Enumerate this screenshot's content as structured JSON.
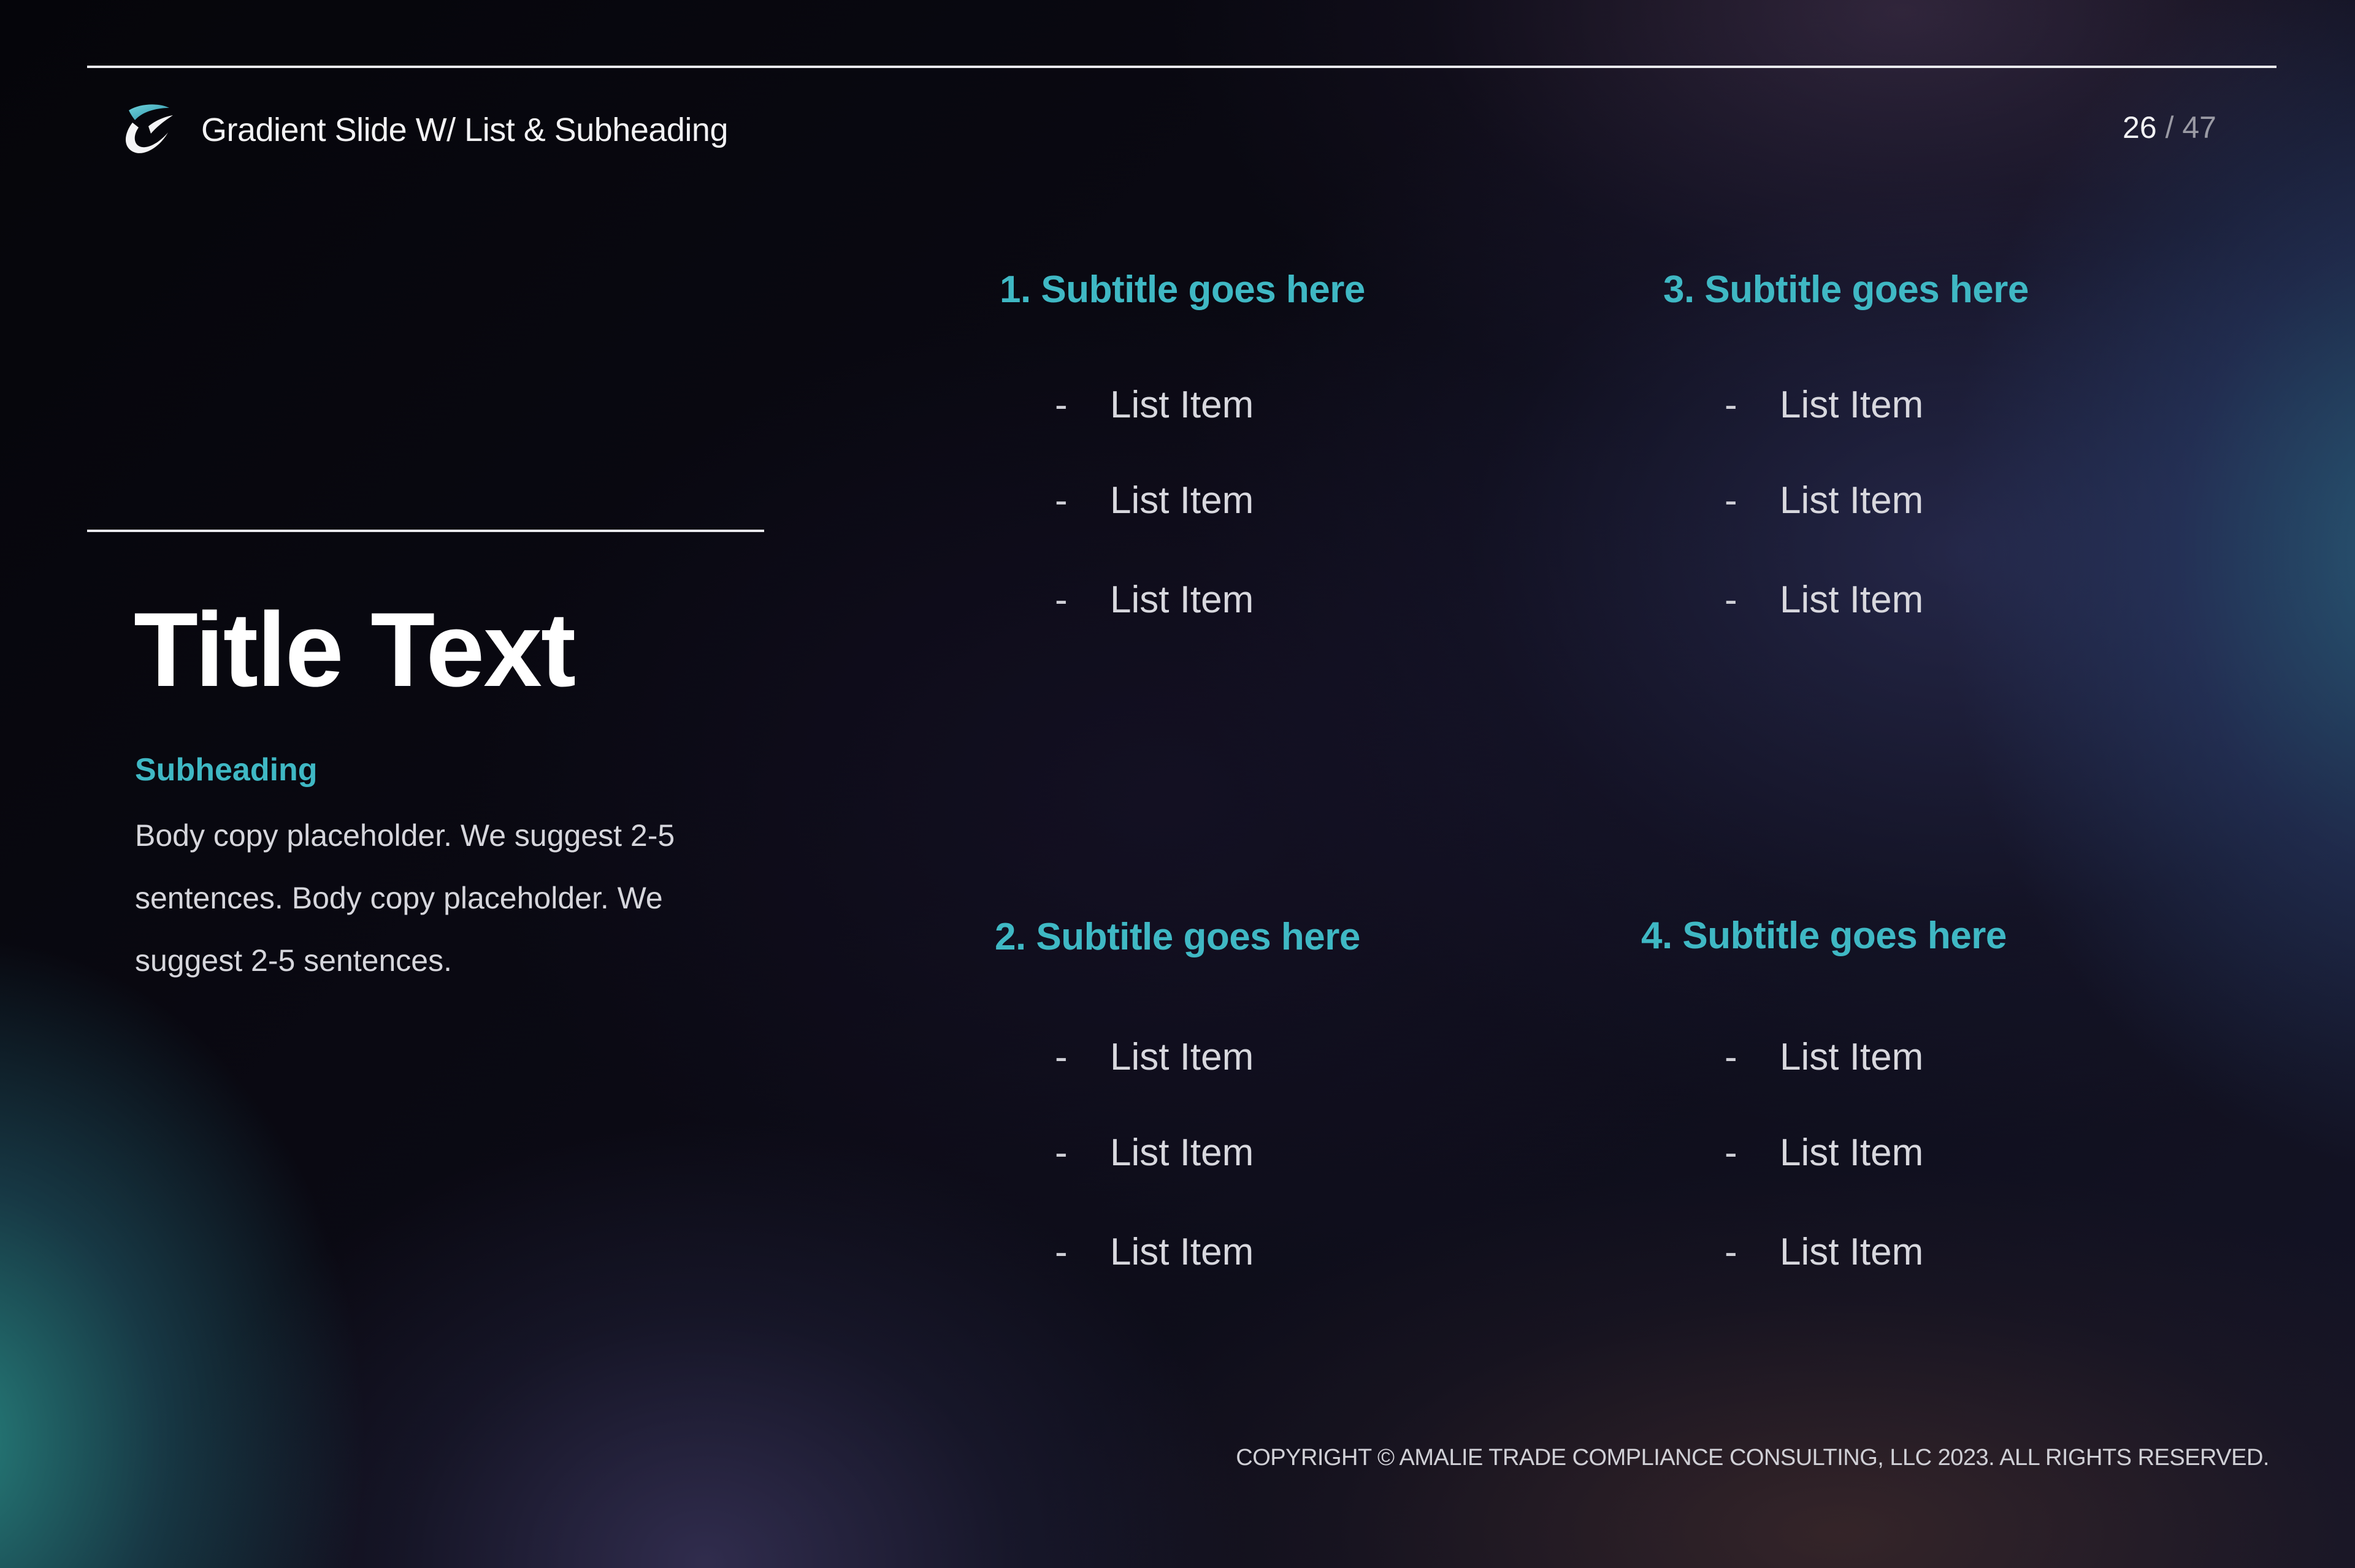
{
  "header": {
    "logo_icon": "brand-swoosh-logo",
    "title": "Gradient Slide W/ List & Subheading",
    "page": {
      "current": "26",
      "separator": "/",
      "total": "47"
    }
  },
  "left": {
    "title": "Title Text",
    "subheading": "Subheading",
    "body": "Body copy placeholder. We suggest 2-5 sentences. Body copy placeholder. We suggest 2-5 sentences."
  },
  "sections": [
    {
      "subtitle": "1. Subtitle goes here",
      "items": [
        {
          "dash": "-",
          "text": "List Item"
        },
        {
          "dash": "-",
          "text": "List Item"
        },
        {
          "dash": "-",
          "text": "List Item"
        }
      ]
    },
    {
      "subtitle": "2. Subtitle goes here",
      "items": [
        {
          "dash": "-",
          "text": "List Item"
        },
        {
          "dash": "-",
          "text": "List Item"
        },
        {
          "dash": "-",
          "text": "List Item"
        }
      ]
    },
    {
      "subtitle": "3. Subtitle goes here",
      "items": [
        {
          "dash": "-",
          "text": "List Item"
        },
        {
          "dash": "-",
          "text": "List Item"
        },
        {
          "dash": "-",
          "text": "List Item"
        }
      ]
    },
    {
      "subtitle": "4. Subtitle goes here",
      "items": [
        {
          "dash": "-",
          "text": "List Item"
        },
        {
          "dash": "-",
          "text": "List Item"
        },
        {
          "dash": "-",
          "text": "List Item"
        }
      ]
    }
  ],
  "footer": {
    "copyright": "COPYRIGHT © AMALIE TRADE COMPLIANCE CONSULTING, LLC 2023.  ALL RIGHTS RESERVED."
  },
  "colors": {
    "accent": "#3fb8c4",
    "text": "#f2f2f4",
    "muted": "#9a9aa4",
    "background": "#07070b"
  }
}
